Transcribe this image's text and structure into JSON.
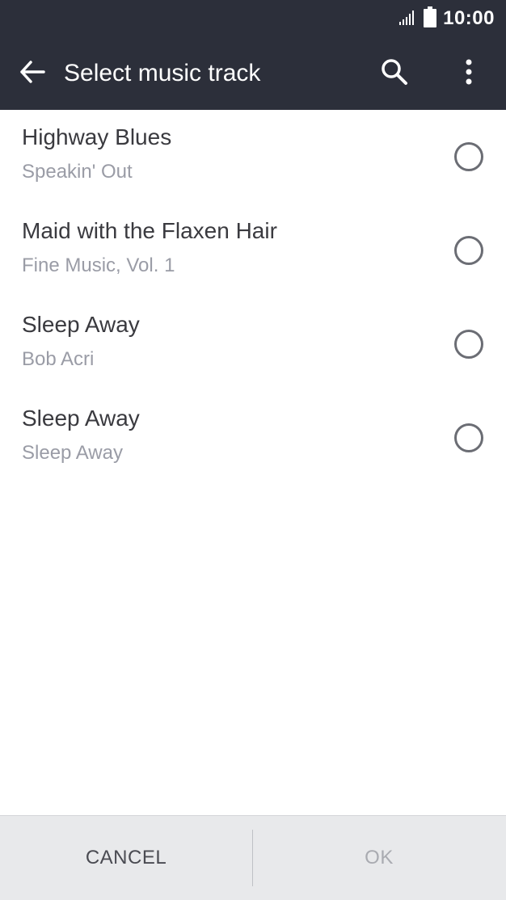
{
  "status_bar": {
    "time": "10:00",
    "signal_icon": "signal-icon",
    "battery_icon": "battery-icon"
  },
  "app_bar": {
    "title": "Select music track",
    "back_icon": "back-arrow-icon",
    "search_icon": "search-icon",
    "more_icon": "more-vert-icon",
    "background": "#2c2f3a"
  },
  "tracks": [
    {
      "title": "Highway Blues",
      "subtitle": "Speakin' Out",
      "selected": false
    },
    {
      "title": "Maid with the Flaxen Hair",
      "subtitle": "Fine Music, Vol. 1",
      "selected": false
    },
    {
      "title": "Sleep Away",
      "subtitle": "Bob Acri",
      "selected": false
    },
    {
      "title": "Sleep Away",
      "subtitle": "Sleep Away",
      "selected": false
    }
  ],
  "buttons": {
    "cancel": "CANCEL",
    "ok": "OK",
    "ok_enabled": false
  }
}
